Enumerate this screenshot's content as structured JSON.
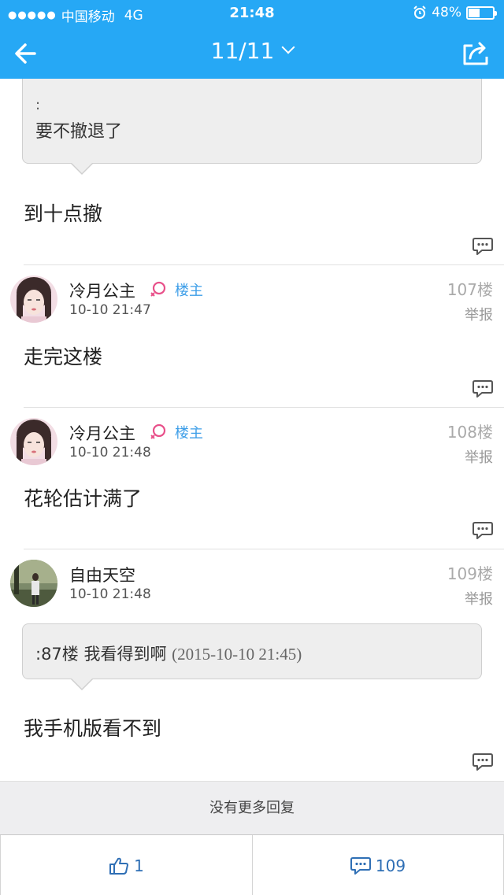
{
  "status_bar": {
    "carrier": "中国移动",
    "network": "4G",
    "time": "21:48",
    "battery": "48%",
    "battery_level": 0.48
  },
  "nav": {
    "page": "11/11",
    "icons": [
      "back-arrow-icon",
      "chevron-down-icon",
      "share-icon"
    ]
  },
  "top_quote": {
    "prefix": ":",
    "text": "要不撤退了"
  },
  "top_body": "到十点撤",
  "posts": [
    {
      "user": "冷月公主",
      "badge": "楼主",
      "time": "10-10 21:47",
      "floor": "107楼",
      "report": "举报",
      "body": "走完这楼"
    },
    {
      "user": "冷月公主",
      "badge": "楼主",
      "time": "10-10 21:48",
      "floor": "108楼",
      "report": "举报",
      "body": "花轮估计满了"
    },
    {
      "user": "自由天空",
      "time": "10-10 21:48",
      "floor": "109楼",
      "report": "举报",
      "quote": ":87楼 我看得到啊",
      "quote_time": "(2015-10-10 21:45)",
      "body": "我手机版看不到"
    }
  ],
  "footer": {
    "no_more": "没有更多回复",
    "like_count": "1",
    "reply_count": "109"
  },
  "colors": {
    "header_bg": "#26a8f5",
    "badge": "#3d9ee8",
    "female_icon": "#e8508a",
    "bottom_text": "#2f6fb5"
  }
}
